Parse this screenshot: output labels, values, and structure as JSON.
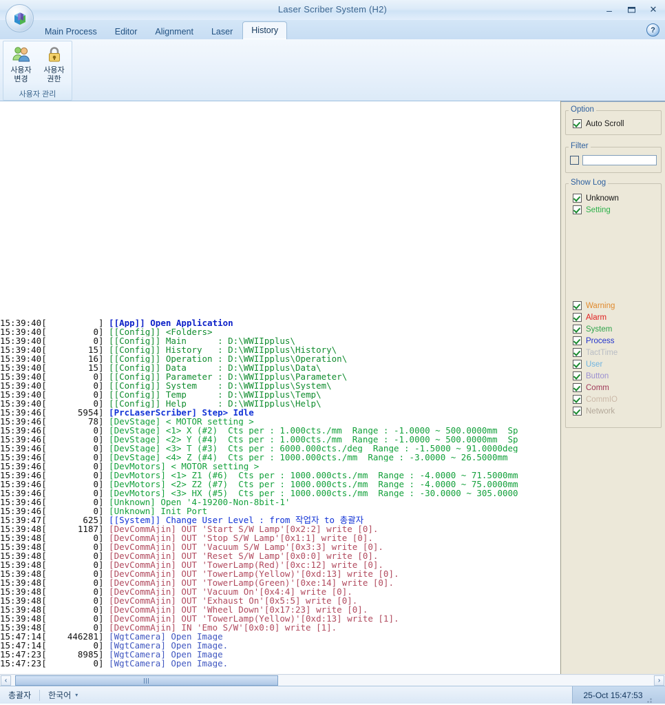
{
  "window": {
    "title": "Laser Scriber System (H2)",
    "minimize_label": "–",
    "maximize_label": "❐",
    "close_label": "✕",
    "help_label": "?"
  },
  "tabs": [
    {
      "label": "Main Process",
      "active": false
    },
    {
      "label": "Editor",
      "active": false
    },
    {
      "label": "Alignment",
      "active": false
    },
    {
      "label": "Laser",
      "active": false
    },
    {
      "label": "History",
      "active": true
    }
  ],
  "ribbon": {
    "group_title": "사용자 관리",
    "buttons": [
      {
        "icon": "users-icon",
        "line1": "사용자",
        "line2": "변경"
      },
      {
        "icon": "lock-icon",
        "line1": "사용자",
        "line2": "권한"
      }
    ]
  },
  "option_panel": {
    "option": {
      "legend": "Option",
      "auto_scroll": {
        "label": "Auto Scroll",
        "checked": true
      }
    },
    "filter": {
      "legend": "Filter",
      "enabled": false,
      "value": "",
      "placeholder": ""
    },
    "show_log": {
      "legend": "Show Log",
      "items": [
        {
          "label": "Unknown",
          "checked": true,
          "color": "#111111"
        },
        {
          "label": "Setting",
          "checked": true,
          "color": "#2db14a"
        },
        {
          "label": "Warning",
          "checked": true,
          "color": "#e08a2e"
        },
        {
          "label": "Alarm",
          "checked": true,
          "color": "#e02020"
        },
        {
          "label": "System",
          "checked": true,
          "color": "#2fa34a"
        },
        {
          "label": "Process",
          "checked": true,
          "color": "#2233cc"
        },
        {
          "label": "TactTime",
          "checked": true,
          "color": "#b9bdc4"
        },
        {
          "label": "User",
          "checked": true,
          "color": "#6fb3e0"
        },
        {
          "label": "Button",
          "checked": true,
          "color": "#9b8fd0"
        },
        {
          "label": "Comm",
          "checked": true,
          "color": "#a03a5a"
        },
        {
          "label": "CommIO",
          "checked": true,
          "color": "#cbb9a8"
        },
        {
          "label": "Network",
          "checked": true,
          "color": "#b3a89a"
        }
      ]
    }
  },
  "log": {
    "lines": [
      {
        "ts": "15:39:40[",
        "ms": "          ]",
        "cls": "lv-app",
        "msg": " [[App]] Open Application"
      },
      {
        "ts": "15:39:40[",
        "ms": "         0]",
        "cls": "lv-config",
        "msg": " [[Config]] <Folders>"
      },
      {
        "ts": "15:39:40[",
        "ms": "         0]",
        "cls": "lv-config",
        "msg": " [[Config]] Main      : D:\\WWIIpplus\\"
      },
      {
        "ts": "15:39:40[",
        "ms": "        15]",
        "cls": "lv-config",
        "msg": " [[Config]] History   : D:\\WWIIpplus\\History\\"
      },
      {
        "ts": "15:39:40[",
        "ms": "        16]",
        "cls": "lv-config",
        "msg": " [[Config]] Operation : D:\\WWIIpplus\\Operation\\"
      },
      {
        "ts": "15:39:40[",
        "ms": "        15]",
        "cls": "lv-config",
        "msg": " [[Config]] Data      : D:\\WWIIpplus\\Data\\"
      },
      {
        "ts": "15:39:40[",
        "ms": "         0]",
        "cls": "lv-config",
        "msg": " [[Config]] Parameter : D:\\WWIIpplus\\Parameter\\"
      },
      {
        "ts": "15:39:40[",
        "ms": "         0]",
        "cls": "lv-config",
        "msg": " [[Config]] System    : D:\\WWIIpplus\\System\\"
      },
      {
        "ts": "15:39:40[",
        "ms": "         0]",
        "cls": "lv-config",
        "msg": " [[Config]] Temp      : D:\\WWIIpplus\\Temp\\"
      },
      {
        "ts": "15:39:40[",
        "ms": "         0]",
        "cls": "lv-config",
        "msg": " [[Config]] Help      : D:\\WWIIpplus\\Help\\"
      },
      {
        "ts": "15:39:46[",
        "ms": "      5954]",
        "cls": "lv-prc",
        "msg": " [PrcLaserScriber] Step> Idle"
      },
      {
        "ts": "15:39:46[",
        "ms": "        78]",
        "cls": "lv-dev",
        "msg": " [DevStage] < MOTOR setting >"
      },
      {
        "ts": "15:39:46[",
        "ms": "         0]",
        "cls": "lv-dev",
        "msg": " [DevStage] <1> X (#2)  Cts per : 1.000cts./mm  Range : -1.0000 ~ 500.0000mm  Sp"
      },
      {
        "ts": "15:39:46[",
        "ms": "         0]",
        "cls": "lv-dev",
        "msg": " [DevStage] <2> Y (#4)  Cts per : 1.000cts./mm  Range : -1.0000 ~ 500.0000mm  Sp"
      },
      {
        "ts": "15:39:46[",
        "ms": "         0]",
        "cls": "lv-dev",
        "msg": " [DevStage] <3> T (#3)  Cts per : 6000.000cts./deg  Range : -1.5000 ~ 91.0000deg"
      },
      {
        "ts": "15:39:46[",
        "ms": "         0]",
        "cls": "lv-dev",
        "msg": " [DevStage] <4> Z (#4)  Cts per : 1000.000cts./mm  Range : -3.0000 ~ 26.5000mm"
      },
      {
        "ts": "15:39:46[",
        "ms": "         0]",
        "cls": "lv-dev",
        "msg": " [DevMotors] < MOTOR setting >"
      },
      {
        "ts": "15:39:46[",
        "ms": "         0]",
        "cls": "lv-dev",
        "msg": " [DevMotors] <1> Z1 (#6)  Cts per : 1000.000cts./mm  Range : -4.0000 ~ 71.5000mm"
      },
      {
        "ts": "15:39:46[",
        "ms": "         0]",
        "cls": "lv-dev",
        "msg": " [DevMotors] <2> Z2 (#7)  Cts per : 1000.000cts./mm  Range : -4.0000 ~ 75.0000mm"
      },
      {
        "ts": "15:39:46[",
        "ms": "         0]",
        "cls": "lv-dev",
        "msg": " [DevMotors] <3> HX (#5)  Cts per : 1000.000cts./mm  Range : -30.0000 ~ 305.0000"
      },
      {
        "ts": "15:39:46[",
        "ms": "         0]",
        "cls": "lv-unknown",
        "msg": " [Unknown] Open '4-19200-Non-8bit-1'"
      },
      {
        "ts": "15:39:46[",
        "ms": "         0]",
        "cls": "lv-unknown",
        "msg": " [Unknown] Init Port"
      },
      {
        "ts": "15:39:47[",
        "ms": "       625]",
        "cls": "lv-system",
        "msg": " [[System]] Change User Level : from 작업자 to 총괄자"
      },
      {
        "ts": "15:39:48[",
        "ms": "      1187]",
        "cls": "lv-comm",
        "msg": " [DevCommAjin] OUT 'Start S/W Lamp'[0x2:2] write [0]."
      },
      {
        "ts": "15:39:48[",
        "ms": "         0]",
        "cls": "lv-comm",
        "msg": " [DevCommAjin] OUT 'Stop S/W Lamp'[0x1:1] write [0]."
      },
      {
        "ts": "15:39:48[",
        "ms": "         0]",
        "cls": "lv-comm",
        "msg": " [DevCommAjin] OUT 'Vacuum S/W Lamp'[0x3:3] write [0]."
      },
      {
        "ts": "15:39:48[",
        "ms": "         0]",
        "cls": "lv-comm",
        "msg": " [DevCommAjin] OUT 'Reset S/W Lamp'[0x0:0] write [0]."
      },
      {
        "ts": "15:39:48[",
        "ms": "         0]",
        "cls": "lv-comm",
        "msg": " [DevCommAjin] OUT 'TowerLamp(Red)'[0xc:12] write [0]."
      },
      {
        "ts": "15:39:48[",
        "ms": "         0]",
        "cls": "lv-comm",
        "msg": " [DevCommAjin] OUT 'TowerLamp(Yellow)'[0xd:13] write [0]."
      },
      {
        "ts": "15:39:48[",
        "ms": "         0]",
        "cls": "lv-comm",
        "msg": " [DevCommAjin] OUT 'TowerLamp(Green)'[0xe:14] write [0]."
      },
      {
        "ts": "15:39:48[",
        "ms": "         0]",
        "cls": "lv-comm",
        "msg": " [DevCommAjin] OUT 'Vacuum On'[0x4:4] write [0]."
      },
      {
        "ts": "15:39:48[",
        "ms": "         0]",
        "cls": "lv-comm",
        "msg": " [DevCommAjin] OUT 'Exhaust On'[0x5:5] write [0]."
      },
      {
        "ts": "15:39:48[",
        "ms": "         0]",
        "cls": "lv-comm",
        "msg": " [DevCommAjin] OUT 'Wheel Down'[0x17:23] write [0]."
      },
      {
        "ts": "15:39:48[",
        "ms": "         0]",
        "cls": "lv-comm",
        "msg": " [DevCommAjin] OUT 'TowerLamp(Yellow)'[0xd:13] write [1]."
      },
      {
        "ts": "15:39:48[",
        "ms": "         0]",
        "cls": "lv-comm",
        "msg": " [DevCommAjin] IN 'Emo S/W'[0x0:0] write [1]."
      },
      {
        "ts": "15:47:14[",
        "ms": "    446281]",
        "cls": "lv-cam",
        "msg": " [WgtCamera] Open Image"
      },
      {
        "ts": "15:47:14[",
        "ms": "         0]",
        "cls": "lv-cam",
        "msg": " [WgtCamera] Open Image."
      },
      {
        "ts": "15:47:23[",
        "ms": "      8985]",
        "cls": "lv-cam",
        "msg": " [WgtCamera] Open Image"
      },
      {
        "ts": "15:47:23[",
        "ms": "         0]",
        "cls": "lv-cam",
        "msg": " [WgtCamera] Open Image."
      }
    ]
  },
  "scrollbar": {
    "left_arrow": "‹",
    "right_arrow": "›"
  },
  "statusbar": {
    "user_level": "총괄자",
    "language": "한국어",
    "language_caret": "▾",
    "datetime": "25-Oct 15:47:53"
  }
}
